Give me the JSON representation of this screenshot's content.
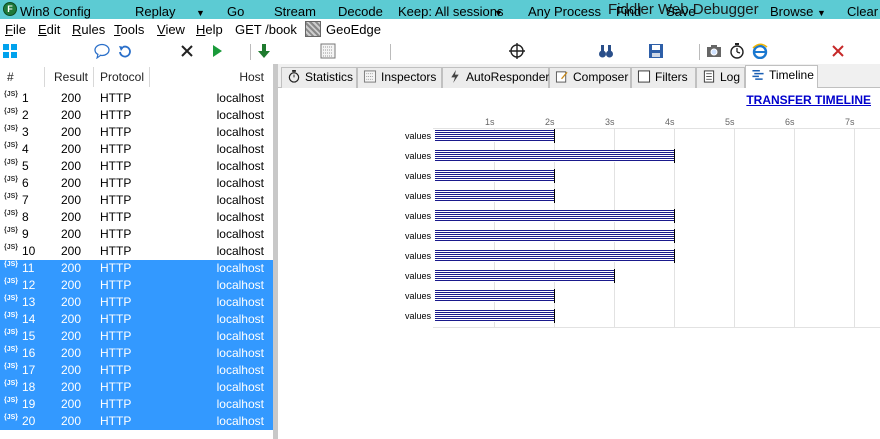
{
  "window": {
    "title": "Fiddler Web Debugger",
    "app_icon_letter": "F"
  },
  "menu": {
    "items": [
      {
        "label": "File",
        "underline": "F",
        "rest": "ile"
      },
      {
        "label": "Edit",
        "underline": "E",
        "rest": "dit"
      },
      {
        "label": "Rules",
        "underline": "R",
        "rest": "ules"
      },
      {
        "label": "Tools",
        "underline": "T",
        "rest": "ools"
      },
      {
        "label": "View",
        "underline": "V",
        "rest": "iew"
      },
      {
        "label": "Help",
        "underline": "H",
        "rest": "elp"
      }
    ],
    "get_book": "GET /book",
    "geoedge": "GeoEdge"
  },
  "toolbar": {
    "win8_config": "Win8 Config",
    "replay": "Replay",
    "go": "Go",
    "stream": "Stream",
    "decode": "Decode",
    "keep": "Keep: All sessions",
    "any_process": "Any Process",
    "find": "Find",
    "save": "Save",
    "browse": "Browse",
    "clear_cache": "Clear C"
  },
  "sessions": {
    "headers": {
      "num": "#",
      "result": "Result",
      "protocol": "Protocol",
      "host": "Host"
    },
    "icon_text": "{JS}",
    "rows": [
      {
        "num": "1",
        "result": "200",
        "protocol": "HTTP",
        "host": "localhost",
        "selected": false
      },
      {
        "num": "2",
        "result": "200",
        "protocol": "HTTP",
        "host": "localhost",
        "selected": false
      },
      {
        "num": "3",
        "result": "200",
        "protocol": "HTTP",
        "host": "localhost",
        "selected": false
      },
      {
        "num": "4",
        "result": "200",
        "protocol": "HTTP",
        "host": "localhost",
        "selected": false
      },
      {
        "num": "5",
        "result": "200",
        "protocol": "HTTP",
        "host": "localhost",
        "selected": false
      },
      {
        "num": "6",
        "result": "200",
        "protocol": "HTTP",
        "host": "localhost",
        "selected": false
      },
      {
        "num": "7",
        "result": "200",
        "protocol": "HTTP",
        "host": "localhost",
        "selected": false
      },
      {
        "num": "8",
        "result": "200",
        "protocol": "HTTP",
        "host": "localhost",
        "selected": false
      },
      {
        "num": "9",
        "result": "200",
        "protocol": "HTTP",
        "host": "localhost",
        "selected": false
      },
      {
        "num": "10",
        "result": "200",
        "protocol": "HTTP",
        "host": "localhost",
        "selected": false
      },
      {
        "num": "11",
        "result": "200",
        "protocol": "HTTP",
        "host": "localhost",
        "selected": true
      },
      {
        "num": "12",
        "result": "200",
        "protocol": "HTTP",
        "host": "localhost",
        "selected": true
      },
      {
        "num": "13",
        "result": "200",
        "protocol": "HTTP",
        "host": "localhost",
        "selected": true
      },
      {
        "num": "14",
        "result": "200",
        "protocol": "HTTP",
        "host": "localhost",
        "selected": true
      },
      {
        "num": "15",
        "result": "200",
        "protocol": "HTTP",
        "host": "localhost",
        "selected": true
      },
      {
        "num": "16",
        "result": "200",
        "protocol": "HTTP",
        "host": "localhost",
        "selected": true
      },
      {
        "num": "17",
        "result": "200",
        "protocol": "HTTP",
        "host": "localhost",
        "selected": true
      },
      {
        "num": "18",
        "result": "200",
        "protocol": "HTTP",
        "host": "localhost",
        "selected": true
      },
      {
        "num": "19",
        "result": "200",
        "protocol": "HTTP",
        "host": "localhost",
        "selected": true
      },
      {
        "num": "20",
        "result": "200",
        "protocol": "HTTP",
        "host": "localhost",
        "selected": true
      }
    ]
  },
  "tabs": [
    {
      "label": "Statistics",
      "icon": "stopwatch-icon",
      "active": false
    },
    {
      "label": "Inspectors",
      "icon": "inspectors-icon",
      "active": false
    },
    {
      "label": "AutoResponder",
      "icon": "lightning-icon",
      "active": false
    },
    {
      "label": "Composer",
      "icon": "composer-icon",
      "active": false
    },
    {
      "label": "Filters",
      "icon": "checkbox-icon",
      "active": false
    },
    {
      "label": "Log",
      "icon": "log-icon",
      "active": false
    },
    {
      "label": "Timeline",
      "icon": "timeline-icon",
      "active": true
    }
  ],
  "timeline": {
    "title": "TRANSFER TIMELINE",
    "bar_color": "#1a1a8c",
    "selection_color": "#3399ff"
  },
  "chart_data": {
    "type": "bar",
    "orientation": "horizontal",
    "title": "TRANSFER TIMELINE",
    "x_ticks": [
      "1s",
      "2s",
      "3s",
      "4s",
      "5s",
      "6s",
      "7s"
    ],
    "xlim": [
      0,
      7.4
    ],
    "x_unit": "s",
    "grid": true,
    "categories": [
      "values",
      "values",
      "values",
      "values",
      "values",
      "values",
      "values",
      "values",
      "values",
      "values"
    ],
    "values": [
      2.0,
      4.0,
      2.0,
      2.0,
      4.0,
      4.0,
      4.0,
      3.0,
      2.0,
      2.0
    ]
  }
}
